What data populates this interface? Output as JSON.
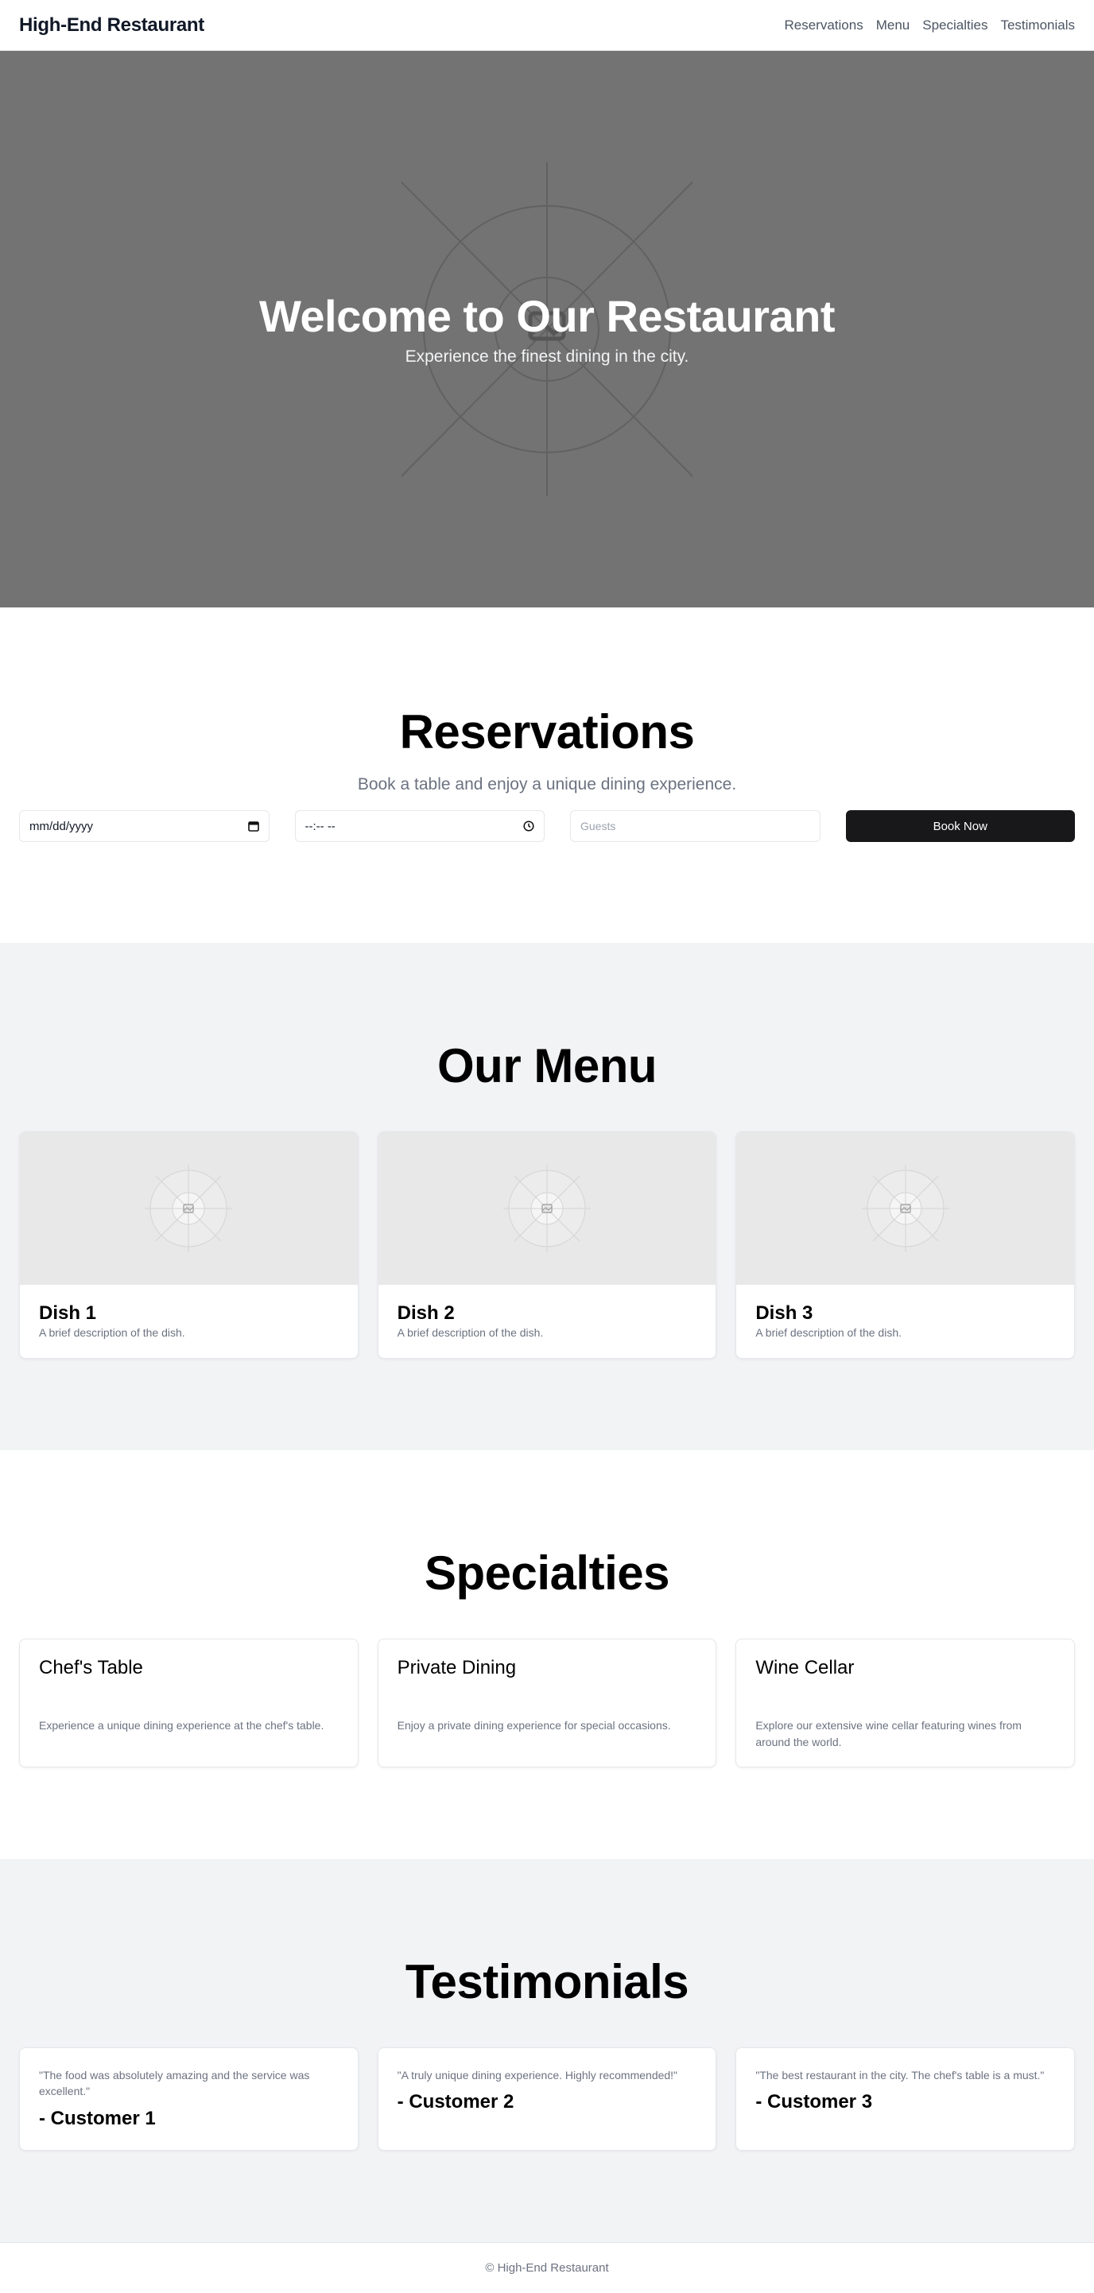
{
  "header": {
    "brand": "High-End Restaurant",
    "nav": [
      "Reservations",
      "Menu",
      "Specialties",
      "Testimonials"
    ]
  },
  "hero": {
    "title": "Welcome to Our Restaurant",
    "subtitle": "Experience the finest dining in the city.",
    "image_icon": "image-placeholder-icon"
  },
  "reservations": {
    "title": "Reservations",
    "subtitle": "Book a table and enjoy a unique dining experience.",
    "date_value": "mm/dd/yyyy",
    "time_value": "--:-- --",
    "guests_placeholder": "Guests",
    "button": "Book Now"
  },
  "menu": {
    "title": "Our Menu",
    "dishes": [
      {
        "name": "Dish 1",
        "description": "A brief description of the dish."
      },
      {
        "name": "Dish 2",
        "description": "A brief description of the dish."
      },
      {
        "name": "Dish 3",
        "description": "A brief description of the dish."
      }
    ]
  },
  "specialties": {
    "title": "Specialties",
    "items": [
      {
        "name": "Chef's Table",
        "description": "Experience a unique dining experience at the chef's table."
      },
      {
        "name": "Private Dining",
        "description": "Enjoy a private dining experience for special occasions."
      },
      {
        "name": "Wine Cellar",
        "description": "Explore our extensive wine cellar featuring wines from around the world."
      }
    ]
  },
  "testimonials": {
    "title": "Testimonials",
    "items": [
      {
        "quote": "\"The food was absolutely amazing and the service was excellent.\"",
        "author": "- Customer 1"
      },
      {
        "quote": "\"A truly unique dining experience. Highly recommended!\"",
        "author": "- Customer 2"
      },
      {
        "quote": "\"The best restaurant in the city. The chef's table is a must.\"",
        "author": "- Customer 3"
      }
    ]
  },
  "footer": {
    "text": "© High-End Restaurant"
  },
  "colors": {
    "hero_bg": "#737373",
    "section_alt_bg": "#f2f3f5",
    "button_bg": "#18181b",
    "muted_text": "#6b7280"
  }
}
